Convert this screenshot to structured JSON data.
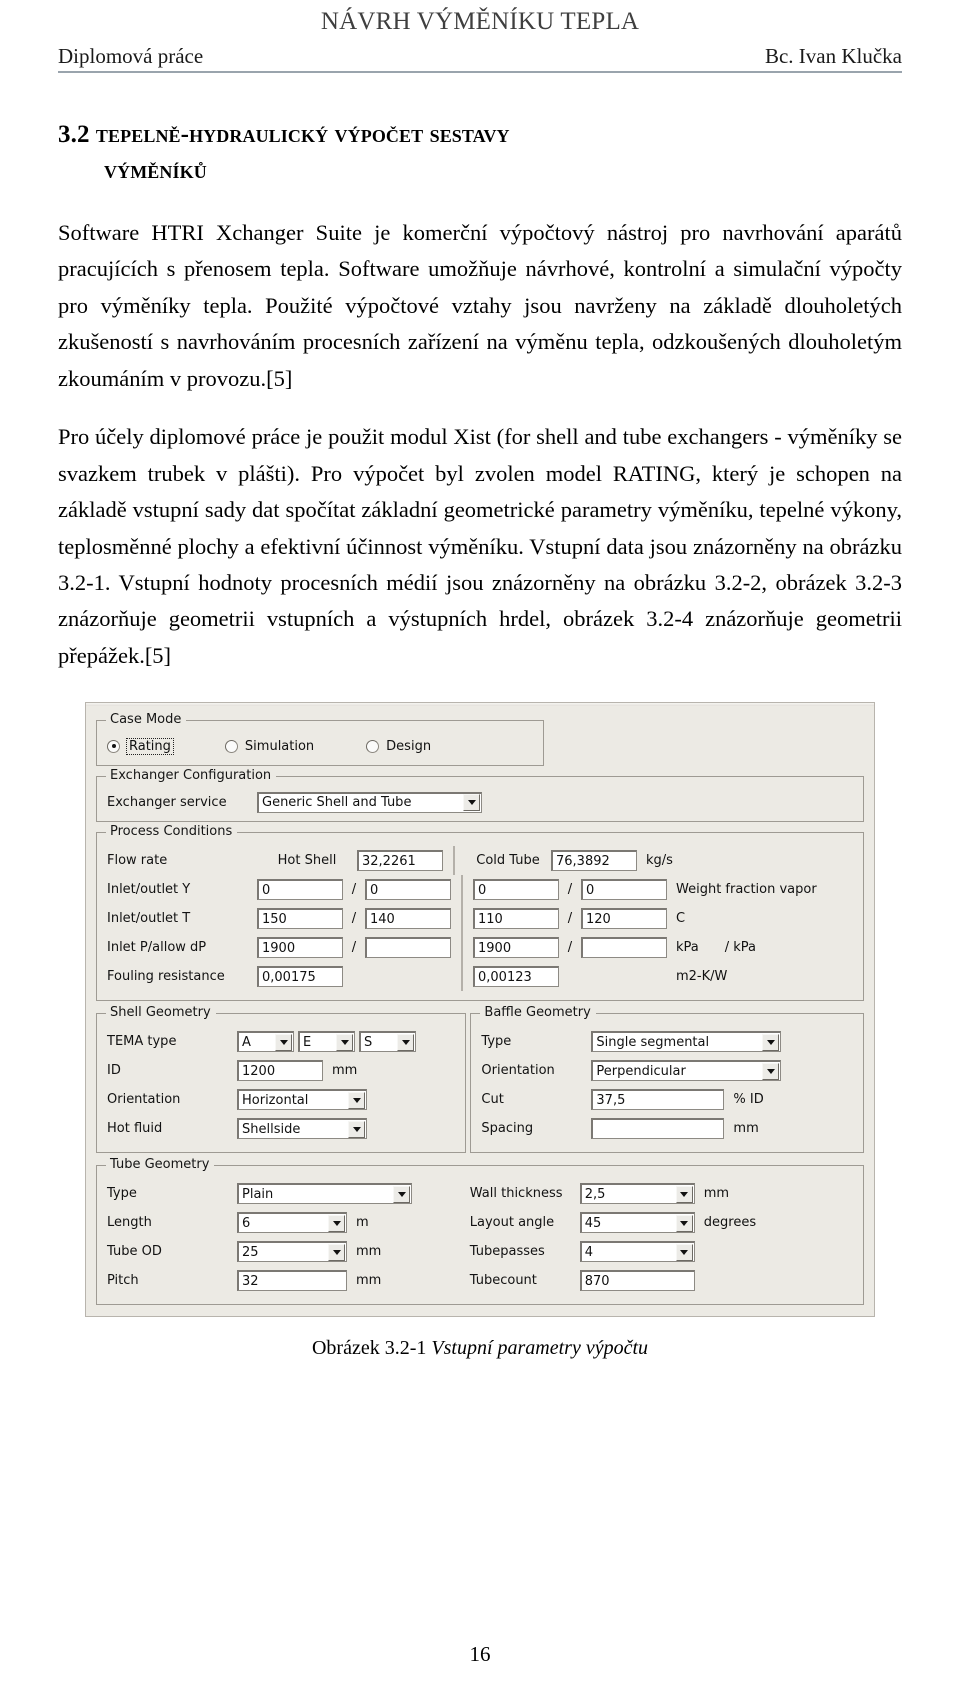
{
  "header": {
    "running_head": "NÁVRH VÝMĚNÍKU TEPLA",
    "left": "Diplomová práce",
    "right": "Bc. Ivan Klučka"
  },
  "heading": {
    "number": "3.2",
    "line1": "Tepelně-hydraulický výpočet sestavy",
    "line2": "výměníků"
  },
  "paragraphs": {
    "p1": "Software HTRI Xchanger Suite je komerční výpočtový nástroj pro navrhování aparátů pracujících s přenosem tepla. Software umožňuje návrhové, kontrolní a simulační výpočty pro výměníky tepla. Použité výpočtové vztahy jsou navrženy na základě dlouholetých zkušeností s navrhováním procesních zařízení na výměnu tepla, odzkoušených dlouholetým zkoumáním v provozu.[5]",
    "p2": "Pro účely diplomové práce je použit modul Xist (for shell and tube exchangers - výměníky se svazkem trubek v plášti). Pro výpočet byl zvolen model RATING, který je schopen na základě vstupní sady dat spočítat základní geometrické parametry výměníku, tepelné výkony, teplosměnné plochy a efektivní účinnost výměníku. Vstupní data jsou znázorněny na obrázku 3.2-1. Vstupní hodnoty procesních médií jsou znázorněny na obrázku 3.2-2, obrázek 3.2-3 znázorňuje geometrii vstupních a výstupních hrdel, obrázek 3.2-4 znázorňuje geometrii přepážek.[5]"
  },
  "screenshot": {
    "case_mode": {
      "title": "Case Mode",
      "options": [
        {
          "label": "Rating",
          "selected": true,
          "focused": true
        },
        {
          "label": "Simulation",
          "selected": false,
          "focused": false
        },
        {
          "label": "Design",
          "selected": false,
          "focused": false
        }
      ]
    },
    "exchanger_configuration": {
      "title": "Exchanger Configuration",
      "service_label": "Exchanger service",
      "service_value": "Generic Shell and Tube"
    },
    "process_conditions": {
      "title": "Process Conditions",
      "hot_label": "Hot Shell",
      "cold_label": "Cold Tube",
      "rows": [
        {
          "label": "Flow rate",
          "hot_in": "32,2261",
          "hot_out": null,
          "cold_in": "76,3892",
          "cold_out": null,
          "unit": "kg/s",
          "unit2": ""
        },
        {
          "label": "Inlet/outlet Y",
          "hot_in": "0",
          "hot_out": "0",
          "cold_in": "0",
          "cold_out": "0",
          "unit": "Weight fraction vapor",
          "unit2": ""
        },
        {
          "label": "Inlet/outlet T",
          "hot_in": "150",
          "hot_out": "140",
          "cold_in": "110",
          "cold_out": "120",
          "unit": "C",
          "unit2": ""
        },
        {
          "label": "Inlet P/allow dP",
          "hot_in": "1900",
          "hot_out": "",
          "cold_in": "1900",
          "cold_out": "",
          "unit": "kPa",
          "unit2": "/   kPa"
        },
        {
          "label": "Fouling resistance",
          "hot_in": "0,00175",
          "hot_out": null,
          "cold_in": "0,00123",
          "cold_out": null,
          "unit": "m2-K/W",
          "unit2": ""
        }
      ]
    },
    "shell_geometry": {
      "title": "Shell Geometry",
      "tema_label": "TEMA type",
      "tema_values": [
        "A",
        "E",
        "S"
      ],
      "id_label": "ID",
      "id_value": "1200",
      "id_unit": "mm",
      "orientation_label": "Orientation",
      "orientation_value": "Horizontal",
      "hot_fluid_label": "Hot fluid",
      "hot_fluid_value": "Shellside"
    },
    "baffle_geometry": {
      "title": "Baffle Geometry",
      "type_label": "Type",
      "type_value": "Single segmental",
      "orientation_label": "Orientation",
      "orientation_value": "Perpendicular",
      "cut_label": "Cut",
      "cut_value": "37,5",
      "cut_unit": "% ID",
      "spacing_label": "Spacing",
      "spacing_value": "",
      "spacing_unit": "mm"
    },
    "tube_geometry": {
      "title": "Tube Geometry",
      "type_label": "Type",
      "type_value": "Plain",
      "length_label": "Length",
      "length_value": "6",
      "length_unit": "m",
      "tube_od_label": "Tube OD",
      "tube_od_value": "25",
      "tube_od_unit": "mm",
      "pitch_label": "Pitch",
      "pitch_value": "32",
      "pitch_unit": "mm",
      "wall_thickness_label": "Wall thickness",
      "wall_thickness_value": "2,5",
      "wall_thickness_unit": "mm",
      "layout_angle_label": "Layout angle",
      "layout_angle_value": "45",
      "layout_angle_unit": "degrees",
      "tubepasses_label": "Tubepasses",
      "tubepasses_value": "4",
      "tubecount_label": "Tubecount",
      "tubecount_value": "870"
    }
  },
  "caption": {
    "prefix": "Obrázek",
    "number": "3.2-1",
    "text": "Vstupní parametry výpočtu"
  },
  "page_number": "16"
}
